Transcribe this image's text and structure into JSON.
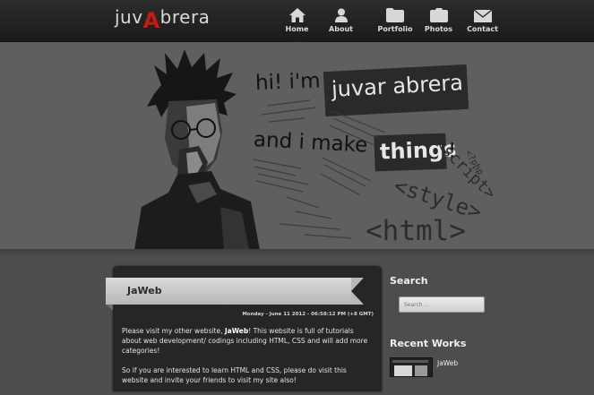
{
  "logo": {
    "part1": "juv",
    "part2": "A",
    "part3": "brera"
  },
  "nav": [
    {
      "label": "Home",
      "icon": "home-icon",
      "active": true
    },
    {
      "label": "About",
      "icon": "user-icon",
      "active": false
    },
    {
      "label": "Portfolio",
      "icon": "folder-icon",
      "active": false
    },
    {
      "label": "Photos",
      "icon": "camera-icon",
      "active": false
    },
    {
      "label": "Contact",
      "icon": "mail-icon",
      "active": false
    }
  ],
  "hero": {
    "line1": "hi! i'm",
    "name": "juvar abrera",
    "line2": "and i make",
    "things": "things",
    "bang": "!",
    "tag_style": "<style>",
    "tag_script": "<script>",
    "tag_php": "<?php",
    "tag_html": "<html>"
  },
  "post": {
    "title": "JaWeb",
    "date": "Monday - June 11 2012 - 06:58:12 PM (+8 GMT)",
    "p1_pre": "Please visit my other website, ",
    "p1_bold": "JaWeb",
    "p1_post": "! This website is full of tutorials about web development/ codings including HTML, CSS and will add more categories!",
    "p2": "So if you are interested to learn HTML and CSS, please do visit this website and invite your friends to visit my site also!"
  },
  "sidebar": {
    "search_heading": "Search",
    "search_placeholder": "Search ...",
    "recent_heading": "Recent Works",
    "recent_items": [
      {
        "title": "JaWeb"
      }
    ]
  },
  "colors": {
    "accent": "#c41a1a",
    "header_bg": "#1f1f1f",
    "hero_bg": "#5f5f5f",
    "body_bg": "#4d4d4d"
  }
}
